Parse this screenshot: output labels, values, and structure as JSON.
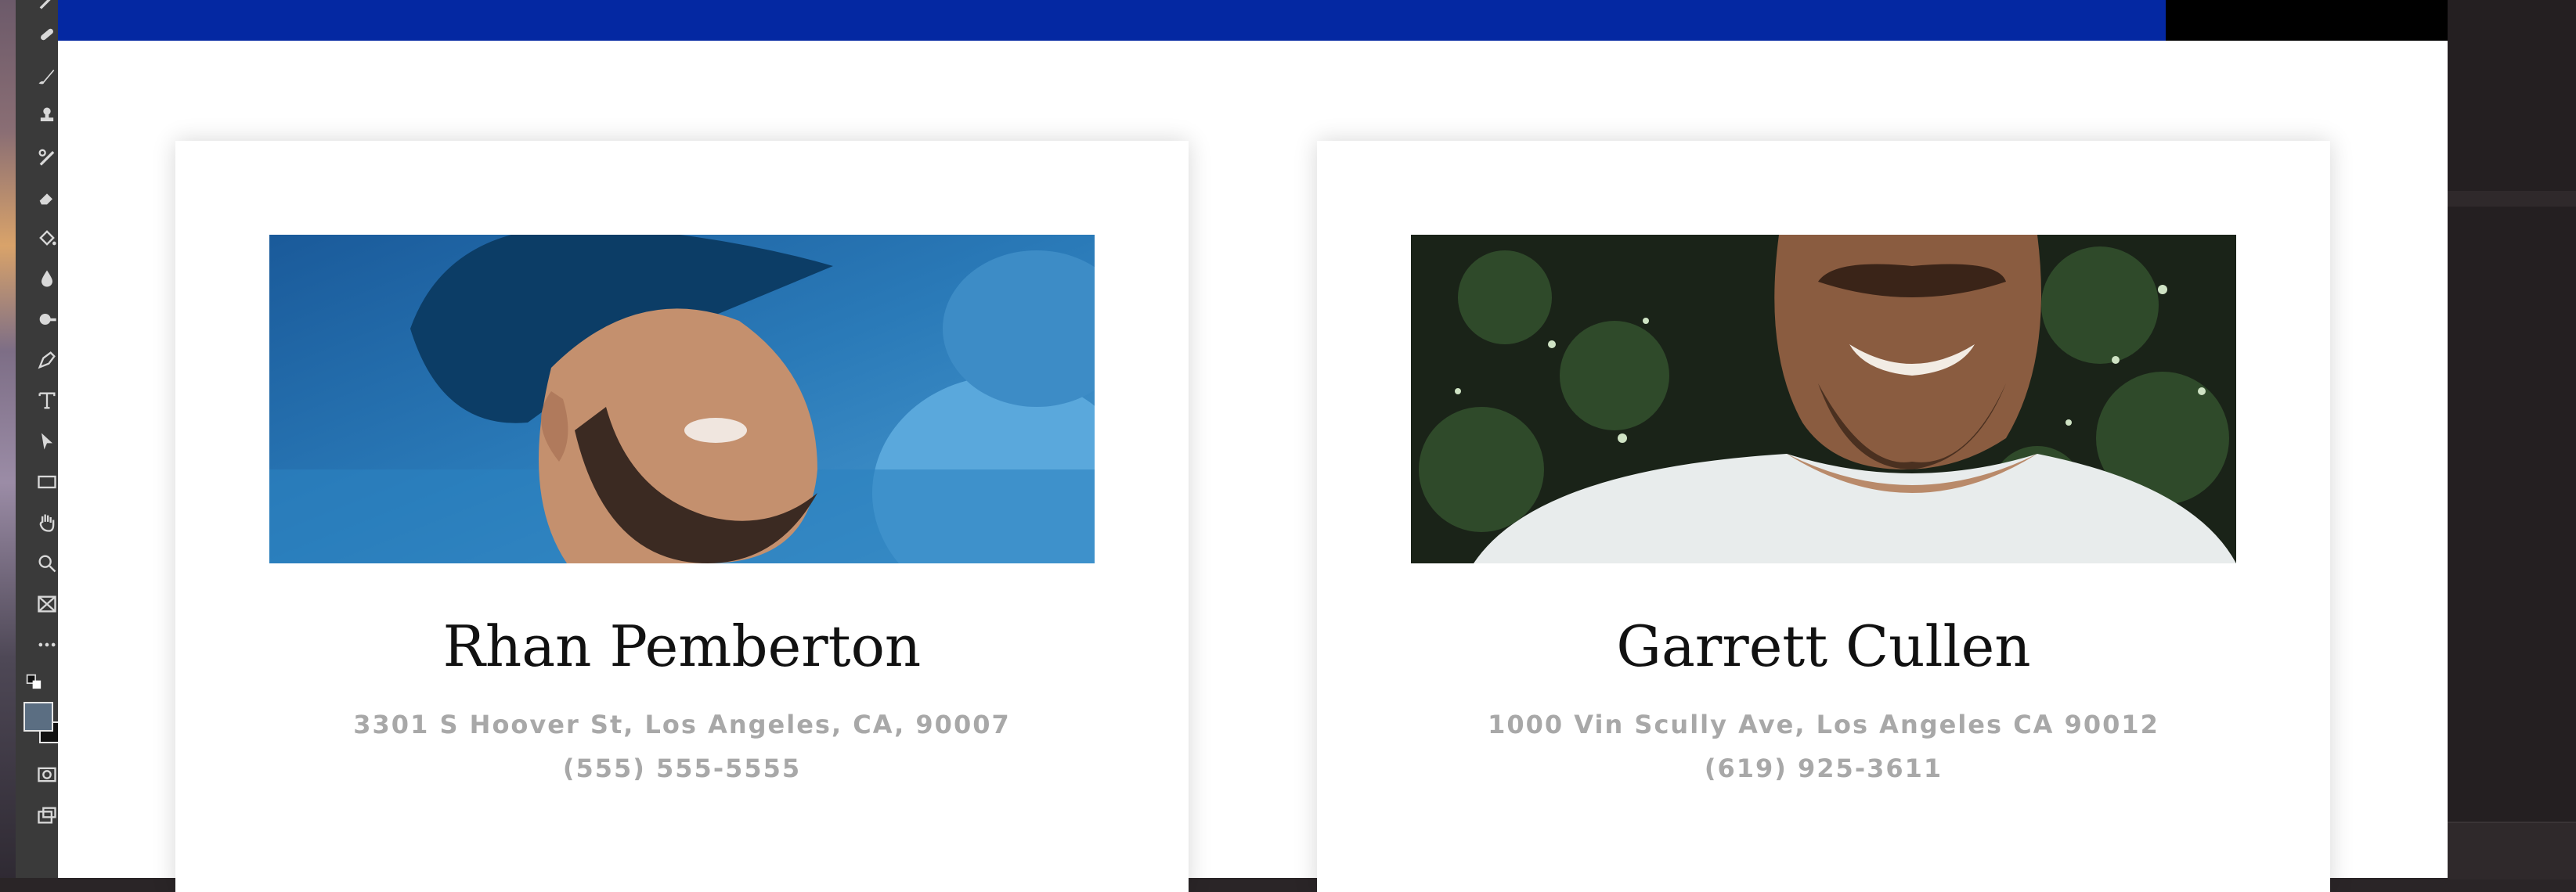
{
  "colors": {
    "header_bar": "#0428a2",
    "card_background": "#ffffff",
    "name_text": "#111111",
    "detail_text": "#a8a8a8"
  },
  "toolbar": {
    "tools": [
      "brush-icon",
      "healing-icon",
      "brush-icon",
      "stamp-icon",
      "history-brush-icon",
      "eraser-icon",
      "paint-bucket-icon",
      "blur-icon",
      "dodge-icon",
      "pen-icon",
      "type-icon",
      "path-selection-icon",
      "rectangle-icon",
      "hand-icon",
      "zoom-icon",
      "frame-icon",
      "more-icon"
    ]
  },
  "contacts": [
    {
      "name": "Rhan Pemberton",
      "address": "3301 S Hoover St, Los Angeles, CA, 90007",
      "phone": "(555) 555-5555",
      "photo": "man-in-blue-cap-photo"
    },
    {
      "name": "Garrett Cullen",
      "address": "1000 Vin Scully Ave, Los Angeles CA 90012",
      "phone": "(619) 925-3611",
      "photo": "smiling-man-white-shirt-photo"
    }
  ]
}
